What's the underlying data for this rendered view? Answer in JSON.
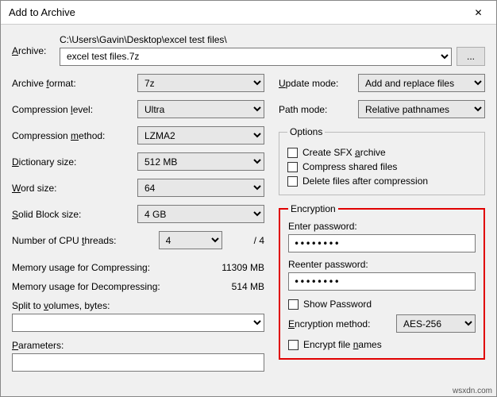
{
  "window": {
    "title": "Add to Archive",
    "close_glyph": "✕"
  },
  "archive": {
    "label": "Archive:",
    "path": "C:\\Users\\Gavin\\Desktop\\excel test files\\",
    "filename": "excel test files.7z",
    "browse_label": "..."
  },
  "left": {
    "format_label_pre": "Archive ",
    "format_label_u": "f",
    "format_label_post": "ormat:",
    "format_value": "7z",
    "level_label_pre": "Compression ",
    "level_label_u": "l",
    "level_label_post": "evel:",
    "level_value": "Ultra",
    "method_label_pre": "Compression ",
    "method_label_u": "m",
    "method_label_post": "ethod:",
    "method_value": "LZMA2",
    "dict_label_u": "D",
    "dict_label_post": "ictionary size:",
    "dict_value": "512 MB",
    "word_label_u": "W",
    "word_label_post": "ord size:",
    "word_value": "64",
    "block_label_u": "S",
    "block_label_post": "olid Block size:",
    "block_value": "4 GB",
    "cpu_label_pre": "Number of CPU ",
    "cpu_label_u": "t",
    "cpu_label_post": "hreads:",
    "cpu_value": "4",
    "cpu_total": "/ 4",
    "mem_comp_label": "Memory usage for Compressing:",
    "mem_comp_value": "11309 MB",
    "mem_decomp_label": "Memory usage for Decompressing:",
    "mem_decomp_value": "514 MB",
    "split_label_pre": "Split to ",
    "split_label_u": "v",
    "split_label_post": "olumes, bytes:",
    "split_value": "",
    "param_label_u": "P",
    "param_label_post": "arameters:",
    "param_value": ""
  },
  "right": {
    "update_label_u": "U",
    "update_label_post": "pdate mode:",
    "update_value": "Add and replace files",
    "path_label": "Path mode:",
    "path_value": "Relative pathnames",
    "options_legend": "Options",
    "sfx_label_pre": "Create SFX ",
    "sfx_label_u": "a",
    "sfx_label_post": "rchive",
    "shared_label_pre": "Compress shared files",
    "delete_label": "Delete files after compression",
    "encryption_legend": "Encryption",
    "enter_pw_label": "Enter password:",
    "enter_pw_value": "••••••••",
    "reenter_pw_label": "Reenter password:",
    "reenter_pw_value": "••••••••",
    "show_pw_label": "Show Password",
    "enc_method_label_u": "E",
    "enc_method_label_post": "ncryption method:",
    "enc_method_value": "AES-256",
    "enc_names_label_pre": "Encrypt file ",
    "enc_names_label_u": "n",
    "enc_names_label_post": "ames"
  },
  "watermark": "wsxdn.com"
}
